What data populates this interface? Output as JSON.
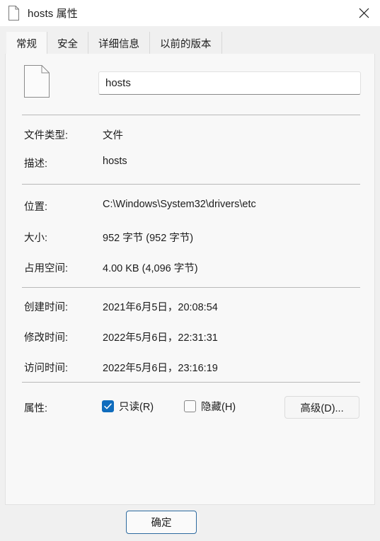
{
  "window": {
    "title": "hosts 属性",
    "title_icon": "file-document-icon",
    "close_icon": "close-icon"
  },
  "tabs": [
    {
      "label": "常规",
      "active": true
    },
    {
      "label": "安全",
      "active": false
    },
    {
      "label": "详细信息",
      "active": false
    },
    {
      "label": "以前的版本",
      "active": false
    }
  ],
  "general": {
    "file_icon": "file-document-icon",
    "name_value": "hosts",
    "name_placeholder": "",
    "rows": [
      {
        "label": "文件类型:",
        "value": "文件"
      },
      {
        "label": "描述:",
        "value": "hosts"
      },
      {
        "label": "位置:",
        "value": "C:\\Windows\\System32\\drivers\\etc"
      },
      {
        "label": "大小:",
        "value": "952 字节 (952 字节)"
      },
      {
        "label": "占用空间:",
        "value": "4.00 KB (4,096 字节)"
      },
      {
        "label": "创建时间:",
        "value": "2021年6月5日，20:08:54"
      },
      {
        "label": "修改时间:",
        "value": "2022年5月6日，22:31:31"
      },
      {
        "label": "访问时间:",
        "value": "2022年5月6日，23:16:19"
      }
    ],
    "attributes": {
      "label": "属性:",
      "readonly_label": "只读(R)",
      "readonly_checked": true,
      "hidden_label": "隐藏(H)",
      "hidden_checked": false,
      "advanced_label": "高级(D)..."
    }
  },
  "footer": {
    "ok_label": "确定"
  },
  "colors": {
    "accent": "#0f6cbd",
    "focus_border": "#2d6a9f",
    "window_bg": "#f0f0f0",
    "panel_bg": "#f8f8f8",
    "separator": "#b9b9b9"
  }
}
